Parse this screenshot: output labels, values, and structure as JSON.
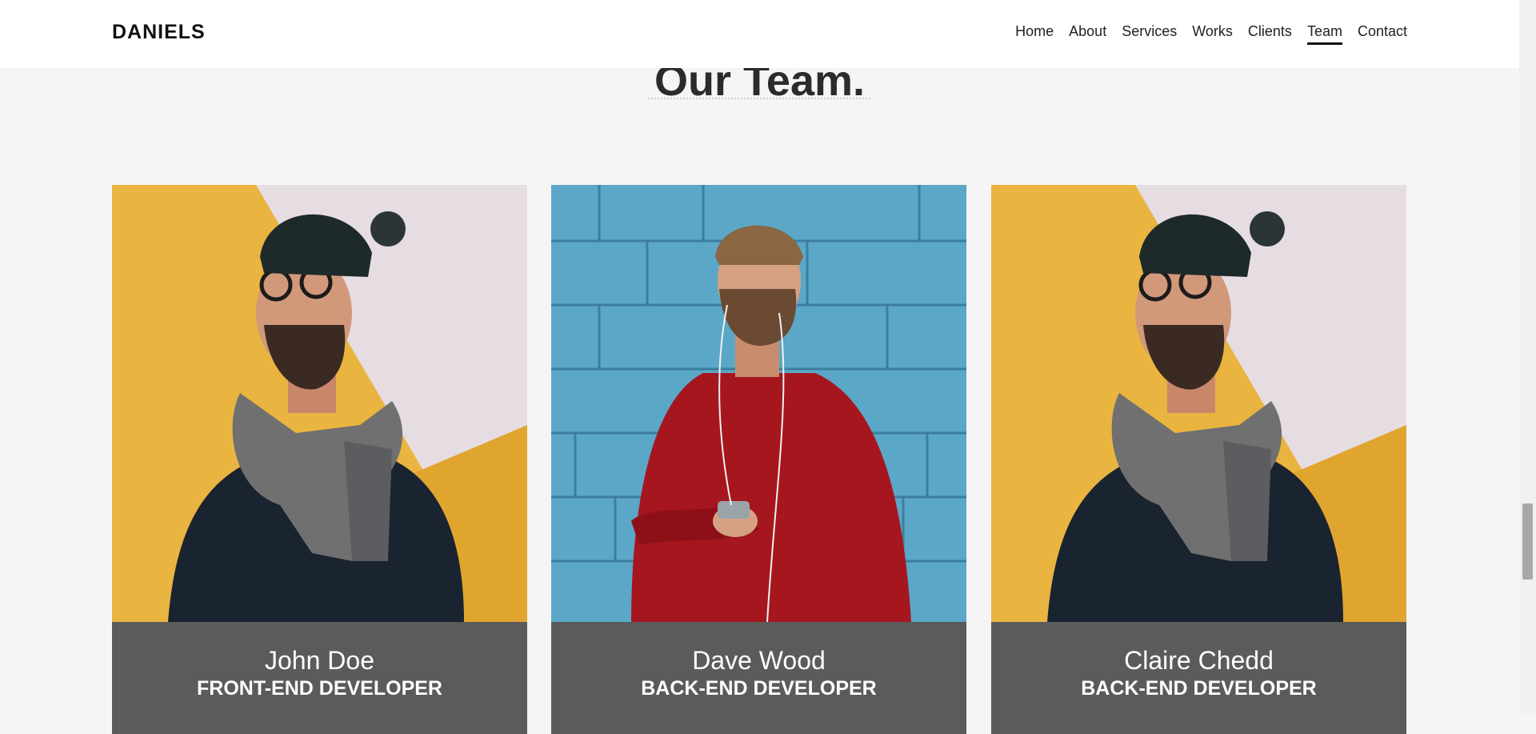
{
  "navbar": {
    "brand": "DANIELS",
    "links": [
      "Home",
      "About",
      "Services",
      "Works",
      "Clients",
      "Team",
      "Contact"
    ],
    "active": "Team"
  },
  "section": {
    "title": "Our Team."
  },
  "team": [
    {
      "name": "John Doe",
      "role": "FRONT-END DEVELOPER",
      "photo": "man-beanie-scarf-yellow-wall"
    },
    {
      "name": "Dave Wood",
      "role": "BACK-END DEVELOPER",
      "photo": "man-red-sweater-blue-wall"
    },
    {
      "name": "Claire Chedd",
      "role": "BACK-END DEVELOPER",
      "photo": "man-beanie-scarf-yellow-wall"
    }
  ],
  "colors": {
    "page_bg": "#f5f5f5",
    "navbar_bg": "#ffffff",
    "card_info_bg": "#5b5b5b",
    "title_color": "#2b2b2b"
  }
}
